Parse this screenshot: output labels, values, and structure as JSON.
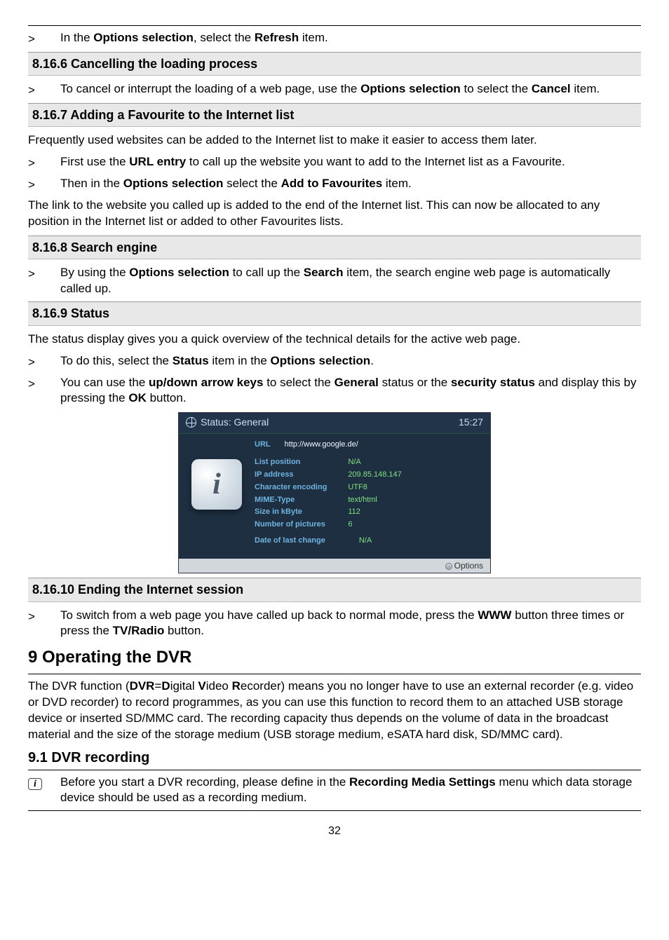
{
  "s1": {
    "gt": ">",
    "p1a": "In the ",
    "p1b": "Options selection",
    "p1c": ", select the ",
    "p1d": "Refresh",
    "p1e": " item."
  },
  "h_8_16_6": "8.16.6 Cancelling the loading process",
  "s2": {
    "gt": ">",
    "a": "To cancel or interrupt the loading of a web page, use the ",
    "b": "Options selection",
    "c": " to select the ",
    "d": "Cancel",
    "e": " item."
  },
  "h_8_16_7": "8.16.7 Adding a Favourite to the Internet list",
  "p_8_16_7_intro": "Frequently used websites can be added to the Internet list to make it easier to access them later.",
  "s3": {
    "gt": ">",
    "a": "First use the ",
    "b": "URL entry",
    "c": " to call up the website you want to add to the Internet list as a Favourite."
  },
  "s4": {
    "gt": ">",
    "a": "Then in the ",
    "b": "Options selection",
    "c": " select the ",
    "d": "Add to Favourites",
    "e": " item."
  },
  "p_8_16_7_outro": "The link to the website you called up is added to the end of the Internet list. This can now be allocated to any position in the Internet list or added to other Favourites lists.",
  "h_8_16_8": "8.16.8 Search engine",
  "s5": {
    "gt": ">",
    "a": "By using the ",
    "b": "Options selection",
    "c": " to call up the ",
    "d": "Search",
    "e": " item, the search engine web page is automatically called up."
  },
  "h_8_16_9": "8.16.9 Status",
  "p_8_16_9_intro": "The status display gives you a quick overview of the technical details for the active web page.",
  "s6": {
    "gt": ">",
    "a": "To do this, select the ",
    "b": "Status",
    "c": " item in the ",
    "d": "Options selection",
    "e": "."
  },
  "s7": {
    "gt": ">",
    "a": "You can use the ",
    "b": "up/down arrow keys",
    "c": " to select the ",
    "d": "General",
    "e": " status or the ",
    "f": "security status",
    "g": " and display this by pressing the ",
    "h": "OK",
    "i": " button."
  },
  "shot": {
    "title": "Status: General",
    "clock": "15:27",
    "url_label": "URL",
    "url_value": "http://www.google.de/",
    "labels": {
      "l1": "List position",
      "l2": "IP address",
      "l3": "Character encoding",
      "l4": "MIME-Type",
      "l5": "Size in kByte",
      "l6": "Number of pictures",
      "l7": "Date of last change"
    },
    "values": {
      "v1": "N/A",
      "v2": "209.85.148.147",
      "v3": "UTF8",
      "v4": "text/html",
      "v5": "112",
      "v6": "6",
      "v7": "N/A"
    },
    "footer": "Options",
    "i_glyph": "i"
  },
  "h_8_16_10": "8.16.10 Ending the Internet session",
  "s8": {
    "gt": ">",
    "a": "To switch from a web page you have called up back to normal mode, press the ",
    "b": "WWW",
    "c": " button three times or press the ",
    "d": "TV/Radio",
    "e": " button."
  },
  "h_9": "9 Operating the DVR",
  "p_9_a": "The DVR function (",
  "p_9_b": "DVR",
  "p_9_c": "=",
  "p_9_d": "D",
  "p_9_e": "igital ",
  "p_9_f": "V",
  "p_9_g": "ideo ",
  "p_9_h": "R",
  "p_9_i": "ecorder) means you no longer have to use an external recorder (e.g. video or DVD recorder) to record programmes, as you can use this function to record them to an attached USB storage device or inserted SD/MMC card. The recording capacity thus depends on the volume of data in the broadcast material and the size of the storage medium (USB storage medium, eSATA hard disk, SD/MMC card).",
  "h_9_1": "9.1 DVR recording",
  "info": {
    "i": "i",
    "a": "Before you start a DVR recording, please define in the ",
    "b": "Recording Media Settings",
    "c": " menu which data storage device should be used as a recording medium."
  },
  "page": "32"
}
